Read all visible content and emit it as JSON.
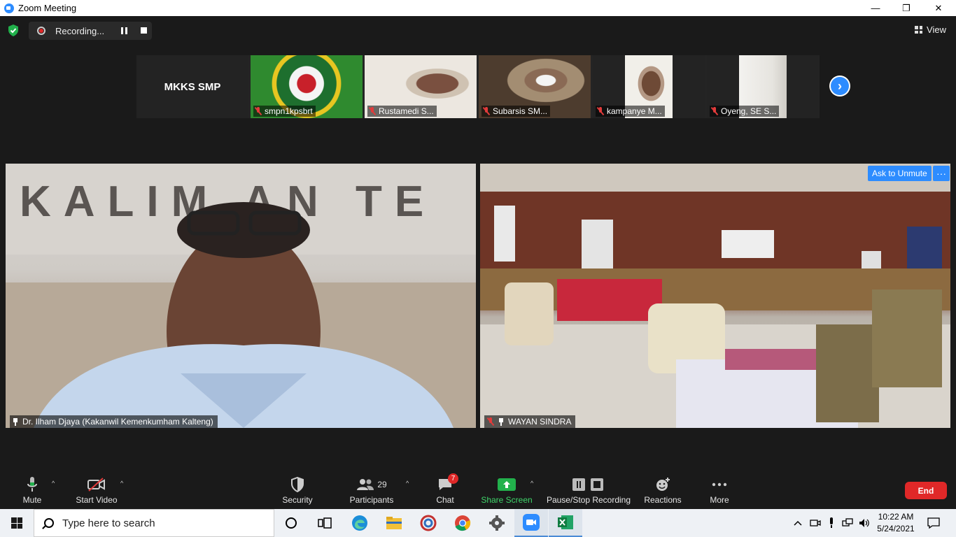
{
  "window": {
    "title": "Zoom Meeting",
    "controls": {
      "minimize": "—",
      "restore": "❐",
      "close": "✕"
    }
  },
  "topbar": {
    "recording_label": "Recording...",
    "view_label": "View"
  },
  "gallery": {
    "tiles": [
      {
        "name": "MKKS SMP",
        "type": "text"
      },
      {
        "name": "smpn1kpsbrt",
        "muted": true
      },
      {
        "name": "Rustamedi S...",
        "muted": true
      },
      {
        "name": "Subarsis SM...",
        "muted": true
      },
      {
        "name": "kampanye M...",
        "muted": true
      },
      {
        "name": "Oyeng, SE S...",
        "muted": true
      }
    ],
    "next_icon": "chevron-right-icon"
  },
  "main": {
    "left_video": {
      "name": "Dr. Ilham Djaya (Kakanwil Kemenkumham Kalteng)",
      "pinned": true
    },
    "right_video": {
      "name": "WAYAN SINDRA",
      "pinned": true,
      "muted": true
    },
    "ask_to_unmute": "Ask to Unmute",
    "more_options": "···"
  },
  "toolbar": {
    "mute": "Mute",
    "start_video": "Start Video",
    "security": "Security",
    "participants": "Participants",
    "participants_count": "29",
    "chat": "Chat",
    "chat_badge": "7",
    "share_screen": "Share Screen",
    "pause_stop_recording": "Pause/Stop Recording",
    "reactions": "Reactions",
    "more": "More",
    "end": "End",
    "caret": "^"
  },
  "taskbar": {
    "search_placeholder": "Type here to search",
    "time": "10:22 AM",
    "date": "5/24/2021"
  },
  "colors": {
    "accent": "#2d8cff",
    "end_red": "#e02828",
    "share_green": "#22b14c",
    "background": "#1a1a1a"
  }
}
